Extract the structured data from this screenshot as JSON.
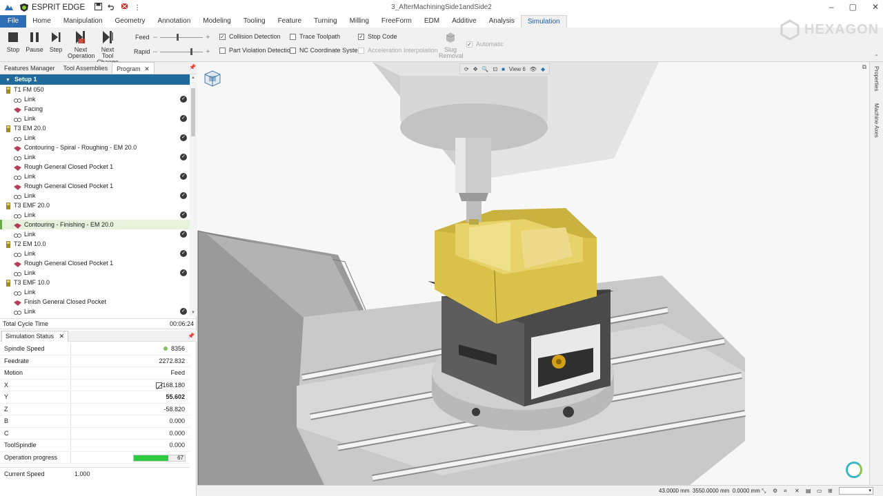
{
  "app": {
    "name": "ESPRIT EDGE",
    "document_title": "3_AfterMachiningSide1andSide2",
    "brand": "HEXAGON",
    "accent_color": "#2d6eb5"
  },
  "tabs": [
    "File",
    "Home",
    "Manipulation",
    "Geometry",
    "Annotation",
    "Modeling",
    "Tooling",
    "Feature",
    "Turning",
    "Milling",
    "FreeForm",
    "EDM",
    "Additive",
    "Analysis",
    "Simulation"
  ],
  "active_tab": "Simulation",
  "ribbon": {
    "stop": "Stop",
    "pause": "Pause",
    "step": "Step",
    "next_op_1": "Next",
    "next_op_2": "Operation",
    "next_tool_1": "Next Tool",
    "next_tool_2": "Change",
    "feed_label": "Feed",
    "rapid_label": "Rapid",
    "collision": "Collision Detection",
    "trace": "Trace Toolpath",
    "stop_code": "Stop Code",
    "part_violation": "Part Violation Detection",
    "nc_coord": "NC Coordinate System",
    "accel_interp": "Acceleration Interpolation",
    "slug_1": "Slug",
    "slug_2": "Removal",
    "automatic": "Automatic"
  },
  "panel_tabs": [
    "Features Manager",
    "Tool Assemblies",
    "Program"
  ],
  "setup": "Setup 1",
  "tree": [
    {
      "label": "T1 FM 050",
      "kind": "tool",
      "level": 0,
      "check": false
    },
    {
      "label": "Link",
      "kind": "link",
      "level": 1,
      "check": true
    },
    {
      "label": "Facing",
      "kind": "op",
      "level": 1,
      "check": false
    },
    {
      "label": "Link",
      "kind": "link",
      "level": 1,
      "check": true
    },
    {
      "label": "T3 EM 20.0",
      "kind": "tool",
      "level": 0,
      "check": false
    },
    {
      "label": "Link",
      "kind": "link",
      "level": 1,
      "check": true
    },
    {
      "label": "Contouring - Spiral - Roughing - EM 20.0",
      "kind": "op",
      "level": 1,
      "check": false
    },
    {
      "label": "Link",
      "kind": "link",
      "level": 1,
      "check": true
    },
    {
      "label": "Rough General Closed Pocket 1",
      "kind": "op",
      "level": 1,
      "check": false
    },
    {
      "label": "Link",
      "kind": "link",
      "level": 1,
      "check": true
    },
    {
      "label": "Rough General Closed Pocket 1",
      "kind": "op",
      "level": 1,
      "check": false
    },
    {
      "label": "Link",
      "kind": "link",
      "level": 1,
      "check": true
    },
    {
      "label": "T3 EMF 20.0",
      "kind": "tool",
      "level": 0,
      "check": false
    },
    {
      "label": "Link",
      "kind": "link",
      "level": 1,
      "check": true
    },
    {
      "label": "Contouring - Finishing - EM 20.0",
      "kind": "op",
      "level": 1,
      "check": false,
      "selected": true
    },
    {
      "label": "Link",
      "kind": "link",
      "level": 1,
      "check": true
    },
    {
      "label": "T2 EM 10.0",
      "kind": "tool",
      "level": 0,
      "check": false
    },
    {
      "label": "Link",
      "kind": "link",
      "level": 1,
      "check": true
    },
    {
      "label": "Rough General Closed Pocket 1",
      "kind": "op",
      "level": 1,
      "check": false
    },
    {
      "label": "Link",
      "kind": "link",
      "level": 1,
      "check": true
    },
    {
      "label": "T3 EMF 10.0",
      "kind": "tool",
      "level": 0,
      "check": false
    },
    {
      "label": "Link",
      "kind": "link",
      "level": 1,
      "check": false
    },
    {
      "label": "Finish General Closed Pocket",
      "kind": "op",
      "level": 1,
      "check": false
    },
    {
      "label": "Link",
      "kind": "link",
      "level": 1,
      "check": true
    }
  ],
  "cycle": {
    "label": "Total Cycle Time",
    "value": "00:06:24"
  },
  "sim_status_title": "Simulation Status",
  "sim_status": [
    {
      "key": "Spindle Speed",
      "value": "8356"
    },
    {
      "key": "Feedrate",
      "value": "2272.832"
    },
    {
      "key": "Motion",
      "value": "Feed"
    },
    {
      "key": "X",
      "value": "-168.180"
    },
    {
      "key": "Y",
      "value": "55.602"
    },
    {
      "key": "Z",
      "value": "-58.820"
    },
    {
      "key": "B",
      "value": "0.000"
    },
    {
      "key": "C",
      "value": "0.000"
    },
    {
      "key": "ToolSpindle",
      "value": "0.000"
    },
    {
      "key": "Operation progress",
      "value": "67"
    }
  ],
  "operation_progress": 0.67,
  "current_speed": {
    "label": "Current Speed",
    "value": "1.000"
  },
  "view_label": "View 6",
  "side_labels": [
    "Properties",
    "Machine Axes"
  ],
  "status_bar": {
    "coords": "43.0000 mm  3550.0000 mm  0.0000 mm"
  }
}
